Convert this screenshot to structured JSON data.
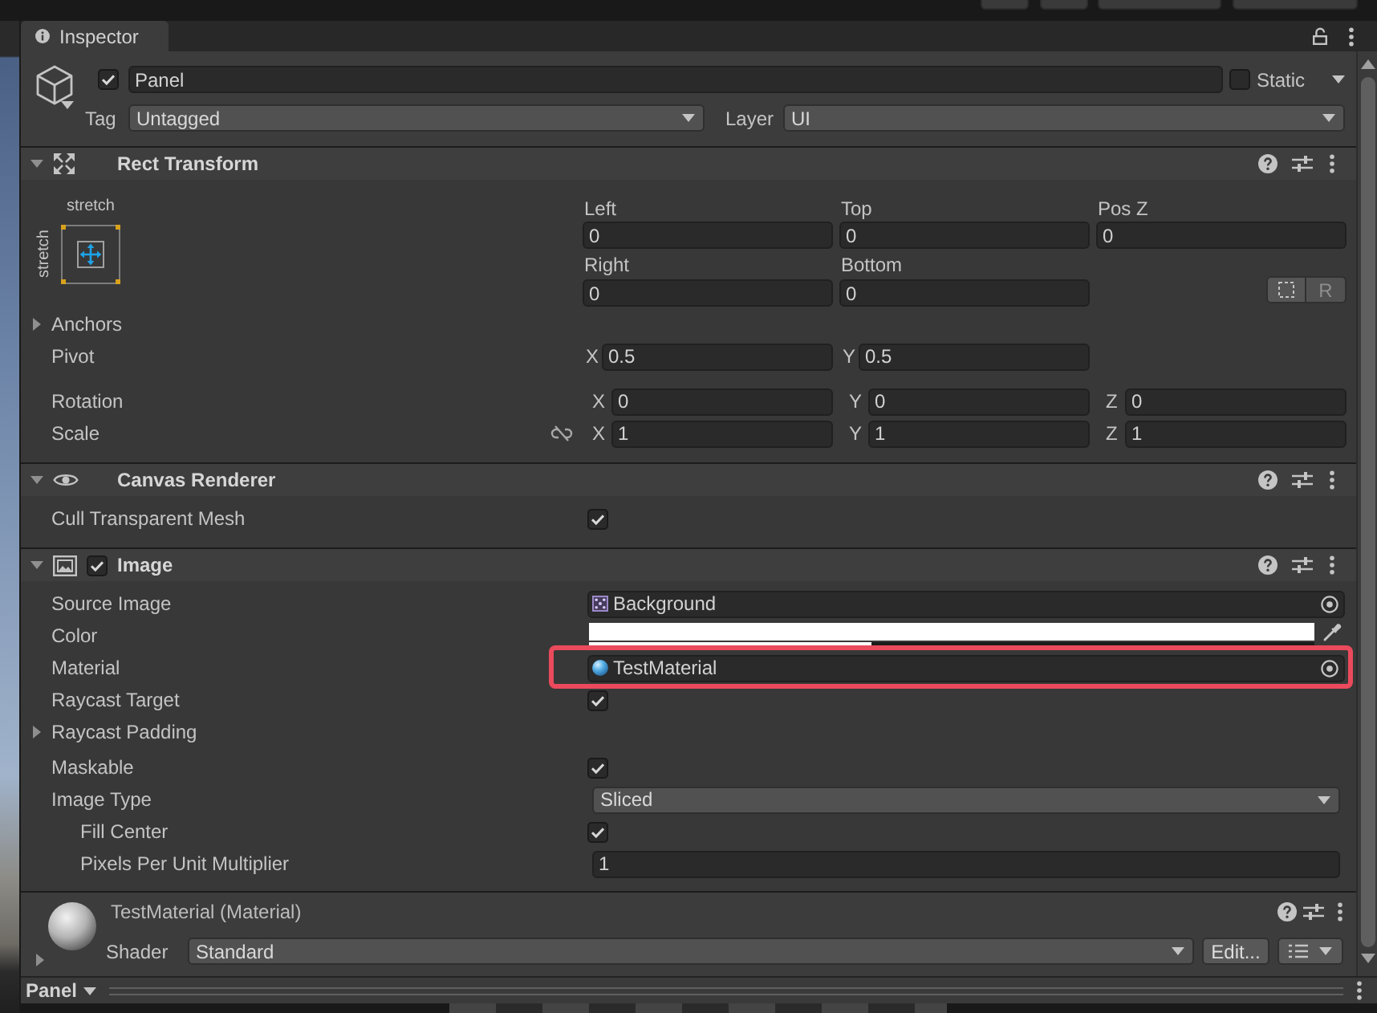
{
  "window": {
    "tab": "Inspector"
  },
  "header": {
    "active": true,
    "name": "Panel",
    "static": {
      "label": "Static",
      "checked": false
    },
    "tag": {
      "label": "Tag",
      "value": "Untagged"
    },
    "layer": {
      "label": "Layer",
      "value": "UI"
    }
  },
  "components": [
    {
      "kind": "rect_transform",
      "title": "Rect Transform",
      "expanded": true,
      "anchor_preset": {
        "horizontal": "stretch",
        "vertical": "stretch"
      },
      "offsets": [
        {
          "label": "Left",
          "value": "0"
        },
        {
          "label": "Top",
          "value": "0"
        },
        {
          "label": "Pos Z",
          "value": "0"
        },
        {
          "label": "Right",
          "value": "0"
        },
        {
          "label": "Bottom",
          "value": "0"
        }
      ],
      "raw_edit_button": "R",
      "rows": [
        {
          "kind": "foldout",
          "label": "Anchors",
          "expanded": false
        },
        {
          "kind": "vector",
          "label": "Pivot",
          "fields": [
            {
              "axis": "X",
              "value": "0.5"
            },
            {
              "axis": "Y",
              "value": "0.5"
            }
          ]
        },
        {
          "kind": "vector",
          "label": "Rotation",
          "fields": [
            {
              "axis": "X",
              "value": "0"
            },
            {
              "axis": "Y",
              "value": "0"
            },
            {
              "axis": "Z",
              "value": "0"
            }
          ]
        },
        {
          "kind": "vector",
          "label": "Scale",
          "linked": false,
          "fields": [
            {
              "axis": "X",
              "value": "1"
            },
            {
              "axis": "Y",
              "value": "1"
            },
            {
              "axis": "Z",
              "value": "1"
            }
          ]
        }
      ]
    },
    {
      "kind": "canvas_renderer",
      "title": "Canvas Renderer",
      "expanded": true,
      "rows": [
        {
          "kind": "toggle",
          "label": "Cull Transparent Mesh",
          "checked": true
        }
      ]
    },
    {
      "kind": "image",
      "title": "Image",
      "expanded": true,
      "enabled": true,
      "rows": [
        {
          "kind": "sprite",
          "label": "Source Image",
          "value": "Background"
        },
        {
          "kind": "color",
          "label": "Color",
          "color": "#ffffff",
          "level": 0.39
        },
        {
          "kind": "material",
          "label": "Material",
          "value": "TestMaterial",
          "highlighted": true
        },
        {
          "kind": "toggle",
          "label": "Raycast Target",
          "checked": true
        },
        {
          "kind": "foldout",
          "label": "Raycast Padding",
          "expanded": false
        },
        {
          "kind": "toggle",
          "label": "Maskable",
          "checked": true
        },
        {
          "kind": "dropdown",
          "label": "Image Type",
          "value": "Sliced",
          "children": [
            {
              "kind": "toggle",
              "label": "Fill Center",
              "checked": true
            },
            {
              "kind": "number",
              "label": "Pixels Per Unit Multiplier",
              "value": "1"
            }
          ]
        }
      ]
    }
  ],
  "material": {
    "title": "TestMaterial (Material)",
    "expanded": false,
    "shader_label": "Shader",
    "shader": "Standard",
    "edit_button": "Edit..."
  },
  "preview_bar": {
    "object": "Panel"
  }
}
